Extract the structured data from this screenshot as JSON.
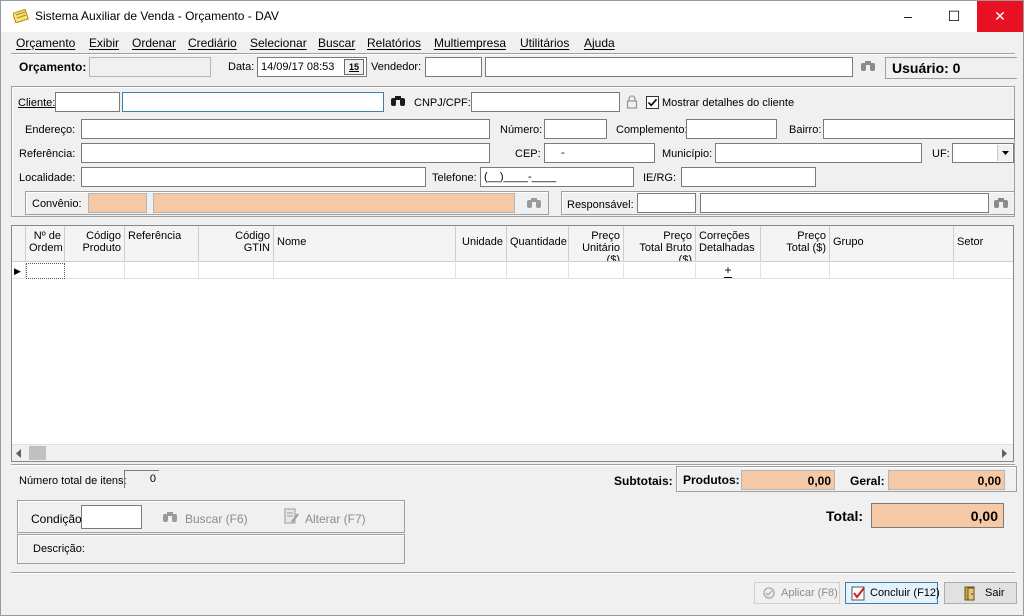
{
  "window": {
    "title": "Sistema Auxiliar de Venda - Orçamento - DAV",
    "minimize": "–",
    "maximize": "☐",
    "close": "✕"
  },
  "menu": [
    "Orçamento",
    "Exibir",
    "Ordenar",
    "Crediário",
    "Selecionar",
    "Buscar",
    "Relatórios",
    "Multiempresa",
    "Utilitários",
    "Ajuda"
  ],
  "header": {
    "orcamento_label": "Orçamento:",
    "orcamento_value": "",
    "data_label": "Data:",
    "data_value": "14/09/17 08:53",
    "calendar_label": "15",
    "vendedor_label": "Vendedor:",
    "vendedor_code": "",
    "vendedor_name": "",
    "usuario_label": "Usuário: 0"
  },
  "cliente": {
    "cliente_label": "Cliente:",
    "cliente_code": "",
    "cliente_name": "",
    "cnpj_label": "CNPJ/CPF:",
    "cnpj_value": "",
    "mostrar_label": "Mostrar detalhes do cliente",
    "mostrar_checked": true,
    "endereco_label": "Endereço:",
    "numero_label": "Número:",
    "complemento_label": "Complemento:",
    "bairro_label": "Bairro:",
    "referencia_label": "Referência:",
    "cep_label": "CEP:",
    "cep_value": "-",
    "municipio_label": "Município:",
    "uf_label": "UF:",
    "localidade_label": "Localidade:",
    "telefone_label": "Telefone:",
    "telefone_value": "(__)____-____",
    "ierg_label": "IE/RG:",
    "convenio_label": "Convênio:",
    "responsavel_label": "Responsável:"
  },
  "grid": {
    "columns": [
      {
        "l1": "Nº de",
        "l2": "Ordem"
      },
      {
        "l1": "Código",
        "l2": "Produto"
      },
      {
        "l1": "Referência",
        "l2": ""
      },
      {
        "l1": "Código",
        "l2": "GTIN"
      },
      {
        "l1": "Nome",
        "l2": ""
      },
      {
        "l1": "Unidade",
        "l2": ""
      },
      {
        "l1": "Quantidade",
        "l2": ""
      },
      {
        "l1": "Preço",
        "l2": "Unitário ($)"
      },
      {
        "l1": "Preço",
        "l2": "Total Bruto ($)"
      },
      {
        "l1": "Correções",
        "l2": "Detalhadas"
      },
      {
        "l1": "Preço",
        "l2": "Total ($)"
      },
      {
        "l1": "Grupo",
        "l2": ""
      },
      {
        "l1": "Setor",
        "l2": ""
      }
    ],
    "row_indicator": "▶",
    "correcoes_icon_text": "+"
  },
  "footer": {
    "num_itens_label": "Número total de itens:",
    "num_itens_value": "0",
    "subtotais_label": "Subtotais:",
    "produtos_label": "Produtos:",
    "produtos_value": "0,00",
    "geral_label": "Geral:",
    "geral_value": "0,00",
    "total_label": "Total:",
    "total_value": "0,00",
    "condicao_label": "Condição:",
    "condicao_value": "",
    "buscar_label": "Buscar (F6)",
    "alterar_label": "Alterar (F7)",
    "descricao_label": "Descrição:"
  },
  "actions": {
    "aplicar": "Aplicar (F8)",
    "concluir": "Concluir (F12)",
    "sair": "Sair"
  },
  "colors": {
    "peach": "#f5c9a6",
    "close_red": "#e81123"
  }
}
